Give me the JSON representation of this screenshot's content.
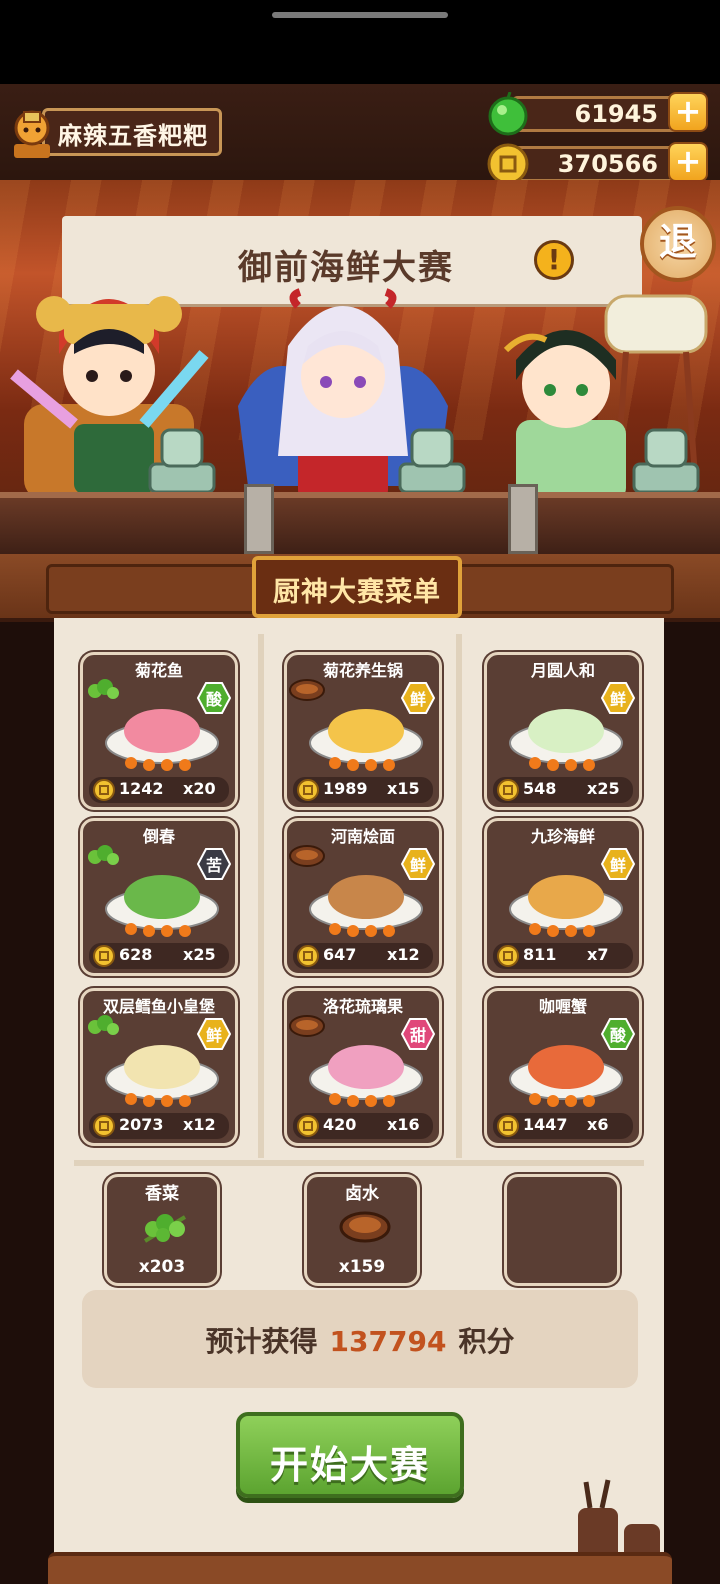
{
  "player": {
    "name": "麻辣五香粑粑"
  },
  "currencies": {
    "jade": {
      "value": "61945",
      "plus": "+",
      "icon": "jade-gem-icon"
    },
    "coins": {
      "value": "370566",
      "plus": "+",
      "icon": "gold-coin-icon"
    }
  },
  "stage": {
    "banner_title": "御前海鲜大赛",
    "alert_mark": "!",
    "exit_label": "退"
  },
  "menu": {
    "title": "厨神大赛菜单",
    "dishes": [
      {
        "name": "菊花鱼",
        "flavor": "酸",
        "flavor_color": "#4fae2e",
        "price": "1242",
        "qty": "x20"
      },
      {
        "name": "菊花养生锅",
        "flavor": "鲜",
        "flavor_color": "#e8b21c",
        "price": "1989",
        "qty": "x15"
      },
      {
        "name": "月圆人和",
        "flavor": "鲜",
        "flavor_color": "#e8b21c",
        "price": "548",
        "qty": "x25"
      },
      {
        "name": "倒春",
        "flavor": "苦",
        "flavor_color": "#3a3a44",
        "price": "628",
        "qty": "x25"
      },
      {
        "name": "河南烩面",
        "flavor": "鲜",
        "flavor_color": "#e8b21c",
        "price": "647",
        "qty": "x12"
      },
      {
        "name": "九珍海鲜",
        "flavor": "鲜",
        "flavor_color": "#e8b21c",
        "price": "811",
        "qty": "x7"
      },
      {
        "name": "双层鳕鱼小皇堡",
        "flavor": "鲜",
        "flavor_color": "#e8b21c",
        "price": "2073",
        "qty": "x12"
      },
      {
        "name": "洛花琉璃果",
        "flavor": "甜",
        "flavor_color": "#e0487a",
        "price": "420",
        "qty": "x16"
      },
      {
        "name": "咖喱蟹",
        "flavor": "酸",
        "flavor_color": "#4fae2e",
        "price": "1447",
        "qty": "x6"
      }
    ],
    "ingredients": [
      {
        "name": "香菜",
        "qty": "x203",
        "icon": "coriander-icon"
      },
      {
        "name": "卤水",
        "qty": "x159",
        "icon": "brine-bowl-icon"
      },
      {
        "name": "",
        "qty": "",
        "icon": ""
      }
    ]
  },
  "estimate": {
    "prefix": "预计获得",
    "points": "137794",
    "suffix": "积分"
  },
  "start_button": {
    "label": "开始大赛"
  },
  "colors": {
    "accent_orange": "#c2521e",
    "start_green": "#5ca430",
    "card_brown": "#5a3e34",
    "paper": "#efe6d8"
  }
}
